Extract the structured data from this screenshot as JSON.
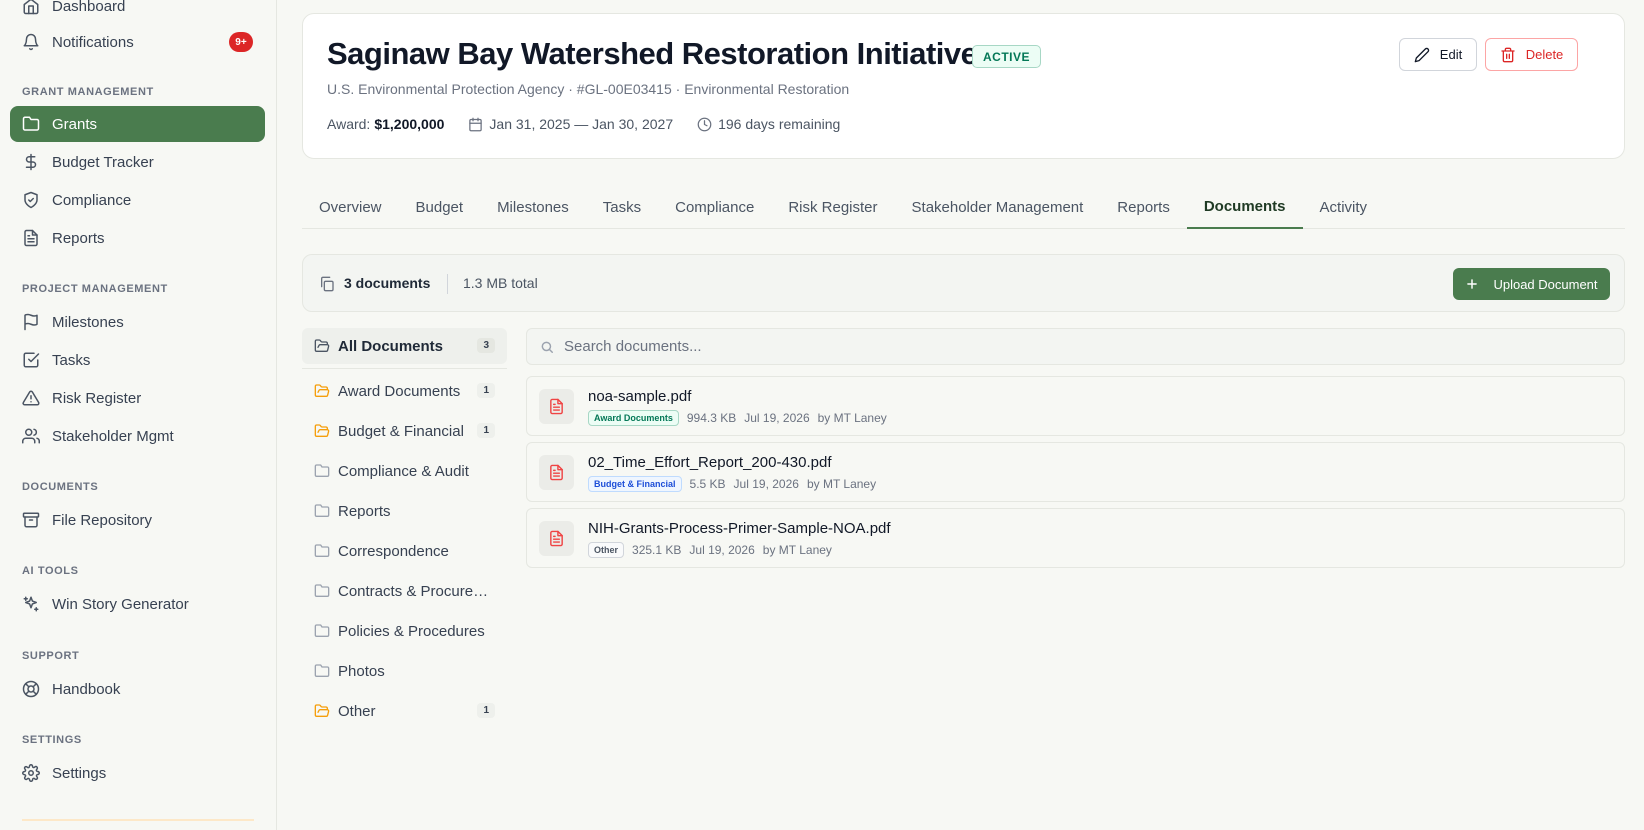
{
  "sidebar": {
    "top_items": [
      {
        "label": "Dashboard",
        "icon": "home-icon"
      },
      {
        "label": "Notifications",
        "icon": "bell-icon",
        "badge": "9+"
      }
    ],
    "sections": [
      {
        "heading": "GRANT MANAGEMENT",
        "items": [
          {
            "label": "Grants",
            "icon": "folder-icon",
            "active": true
          },
          {
            "label": "Budget Tracker",
            "icon": "dollar-icon"
          },
          {
            "label": "Compliance",
            "icon": "shield-check-icon"
          },
          {
            "label": "Reports",
            "icon": "file-text-icon"
          }
        ]
      },
      {
        "heading": "PROJECT MANAGEMENT",
        "items": [
          {
            "label": "Milestones",
            "icon": "flag-icon"
          },
          {
            "label": "Tasks",
            "icon": "check-square-icon"
          },
          {
            "label": "Risk Register",
            "icon": "alert-triangle-icon"
          },
          {
            "label": "Stakeholder Mgmt",
            "icon": "users-icon"
          }
        ]
      },
      {
        "heading": "DOCUMENTS",
        "items": [
          {
            "label": "File Repository",
            "icon": "archive-icon"
          }
        ]
      },
      {
        "heading": "AI TOOLS",
        "items": [
          {
            "label": "Win Story Generator",
            "icon": "sparkles-icon"
          }
        ]
      },
      {
        "heading": "SUPPORT",
        "items": [
          {
            "label": "Handbook",
            "icon": "life-buoy-icon"
          }
        ]
      },
      {
        "heading": "SETTINGS",
        "items": [
          {
            "label": "Settings",
            "icon": "gear-icon"
          }
        ]
      }
    ]
  },
  "grant": {
    "title": "Saginaw Bay Watershed Restoration Initiative",
    "status": "ACTIVE",
    "subtitle": "U.S. Environmental Protection Agency · #GL-00E03415 · Environmental Restoration",
    "award_label": "Award:",
    "award_value": "$1,200,000",
    "date_range": "Jan 31, 2025 — Jan 30, 2027",
    "remaining": "196 days remaining",
    "edit_label": "Edit",
    "delete_label": "Delete"
  },
  "tabs": [
    "Overview",
    "Budget",
    "Milestones",
    "Tasks",
    "Compliance",
    "Risk Register",
    "Stakeholder Management",
    "Reports",
    "Documents",
    "Activity"
  ],
  "active_tab": "Documents",
  "summary": {
    "count": "3 documents",
    "size": "1.3 MB total",
    "upload_label": "Upload Document"
  },
  "categories": [
    {
      "label": "All Documents",
      "count": "3",
      "active": true
    },
    {
      "label": "Award Documents",
      "count": "1"
    },
    {
      "label": "Budget & Financial",
      "count": "1"
    },
    {
      "label": "Compliance & Audit",
      "count": ""
    },
    {
      "label": "Reports",
      "count": ""
    },
    {
      "label": "Correspondence",
      "count": ""
    },
    {
      "label": "Contracts & Procurem...",
      "count": ""
    },
    {
      "label": "Policies & Procedures",
      "count": ""
    },
    {
      "label": "Photos",
      "count": ""
    },
    {
      "label": "Other",
      "count": "1"
    }
  ],
  "search": {
    "placeholder": "Search documents..."
  },
  "documents": [
    {
      "name": "noa-sample.pdf",
      "tag": "Award Documents",
      "tag_color": "#047857",
      "tag_bg": "#ecfdf5",
      "tag_border": "#a7d7c5",
      "size": "994.3 KB",
      "date": "Jul 19, 2026",
      "by": "by MT Laney"
    },
    {
      "name": "02_Time_Effort_Report_200-430.pdf",
      "tag": "Budget & Financial",
      "tag_color": "#1d4ed8",
      "tag_bg": "#eff6ff",
      "tag_border": "#bfdbfe",
      "size": "5.5 KB",
      "date": "Jul 19, 2026",
      "by": "by MT Laney"
    },
    {
      "name": "NIH-Grants-Process-Primer-Sample-NOA.pdf",
      "tag": "Other",
      "tag_color": "#4b5563",
      "tag_bg": "#f9fafb",
      "tag_border": "#d1d5db",
      "size": "325.1 KB",
      "date": "Jul 19, 2026",
      "by": "by MT Laney"
    }
  ]
}
